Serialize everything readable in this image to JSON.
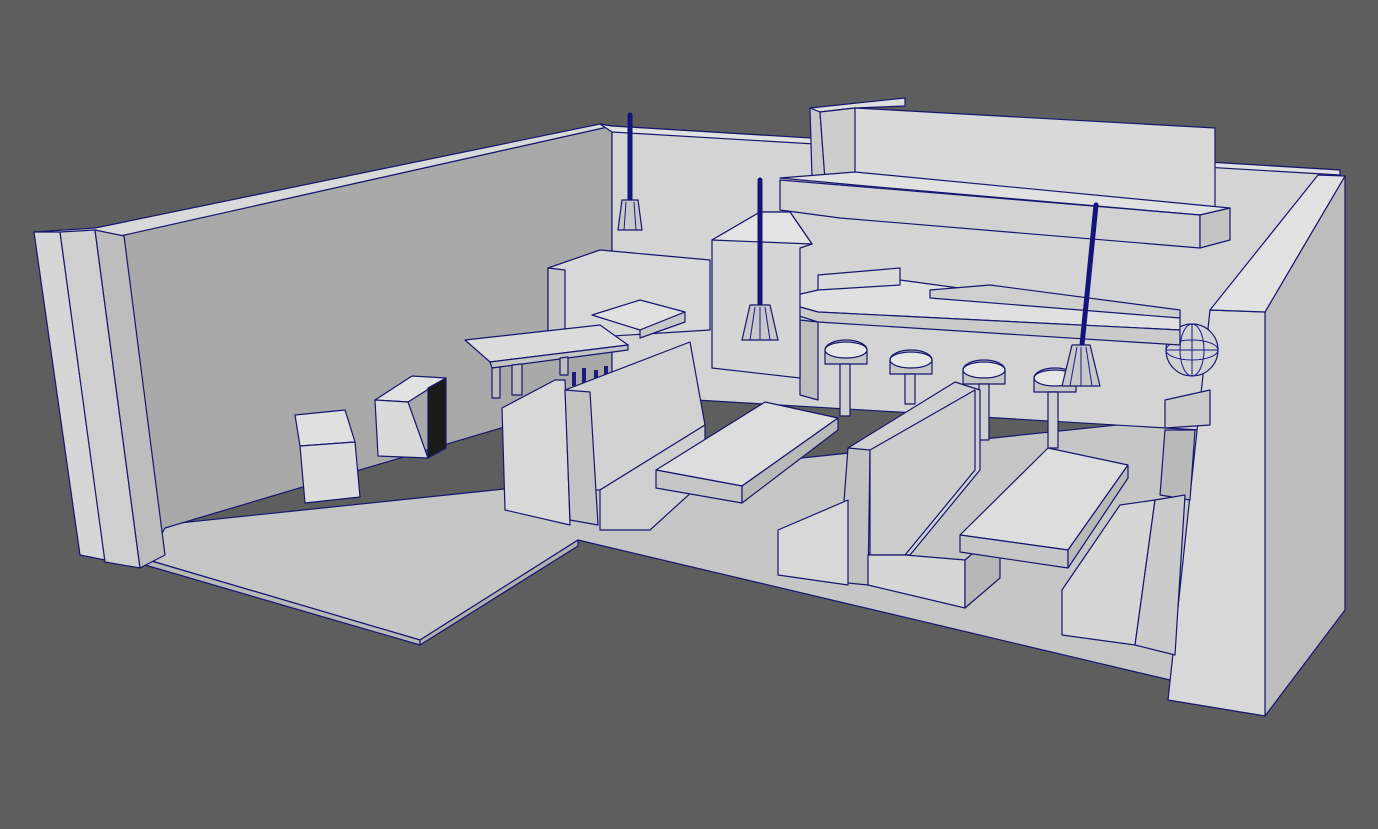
{
  "viewport": {
    "background": "#5e5e5e",
    "mesh_light": "#d6d6d6",
    "mesh_mid": "#c4c4c4",
    "mesh_dark": "#aaaaaa",
    "mesh_shadow": "#bcbcbc",
    "wire_color": "#16166e",
    "selected_face": "#1a1a1a"
  },
  "scene": {
    "objects": [
      "room-floor",
      "back-wall",
      "left-wall",
      "right-wall",
      "upper-shelf",
      "bar-counter",
      "booth-seats",
      "tables",
      "bar-stools",
      "pendant-lamps",
      "range-hood",
      "boxes",
      "globe"
    ]
  }
}
